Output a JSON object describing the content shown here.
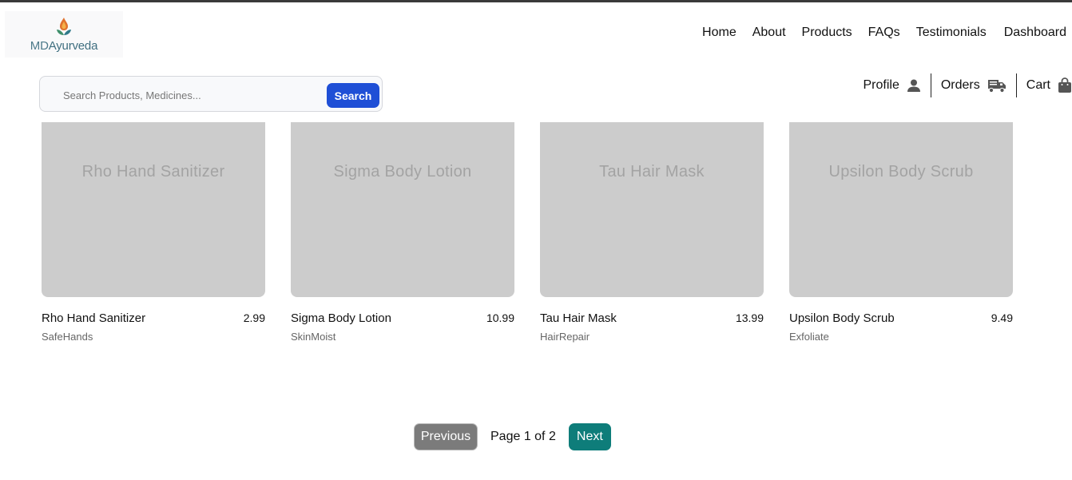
{
  "brand": {
    "logo_prefix": "MD",
    "logo_suffix": "Ayurveda"
  },
  "nav": {
    "items": [
      "Home",
      "About",
      "Products",
      "FAQs",
      "Testimonials",
      "Dashboard"
    ]
  },
  "search": {
    "placeholder": "Search Products, Medicines...",
    "button_label": "Search"
  },
  "user_menu": {
    "profile": "Profile",
    "orders": "Orders",
    "cart": "Cart"
  },
  "products": [
    {
      "image_text": "Rho Hand Sanitizer",
      "name": "Rho Hand Sanitizer",
      "price": "2.99",
      "brand": "SafeHands"
    },
    {
      "image_text": "Sigma Body Lotion",
      "name": "Sigma Body Lotion",
      "price": "10.99",
      "brand": "SkinMoist"
    },
    {
      "image_text": "Tau Hair Mask",
      "name": "Tau Hair Mask",
      "price": "13.99",
      "brand": "HairRepair"
    },
    {
      "image_text": "Upsilon Body Scrub",
      "name": "Upsilon Body Scrub",
      "price": "9.49",
      "brand": "Exfoliate"
    }
  ],
  "pagination": {
    "previous": "Previous",
    "page_text": "Page 1 of 2",
    "next": "Next"
  },
  "colors": {
    "search_button": "#1f4fd6",
    "next_button": "#0e7d7a",
    "previous_button": "#7b7b7b",
    "placeholder_image": "#cccccc"
  },
  "icons": {
    "profile": "user-icon",
    "orders": "truck-icon",
    "cart": "shopping-bag-icon",
    "logo": "flame-leaf-icon"
  }
}
